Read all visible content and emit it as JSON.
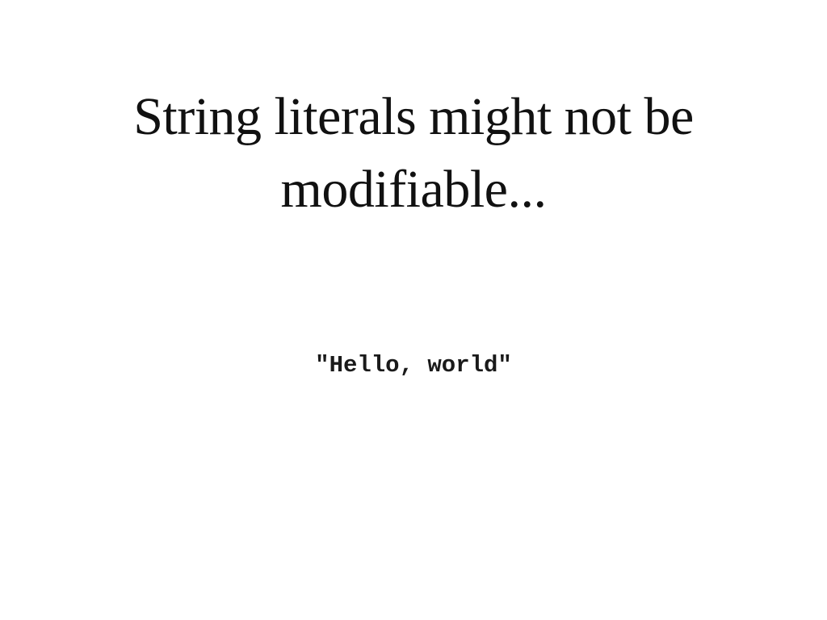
{
  "slide": {
    "title": "String literals might not be modifiable...",
    "code": "\"Hello, world\""
  }
}
